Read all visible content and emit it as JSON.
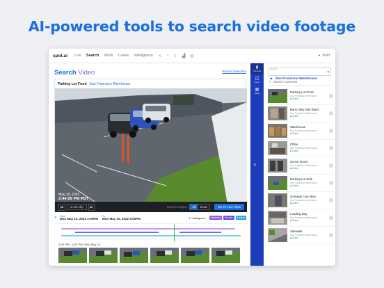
{
  "headline": "AI-powered tools to search video footage",
  "nav": {
    "logo": "spot.ai",
    "items": [
      "Live",
      "Search",
      "Walls",
      "Cases",
      "Intelligence"
    ],
    "active": "Search",
    "user": "Brett"
  },
  "search": {
    "title_main": "Search",
    "title_sub": "Video",
    "recent_link": "Recent Searches"
  },
  "camera_card": {
    "name": "Parking Lot Front",
    "location": "San Francisco Warehouse",
    "timestamp_date": "May 10, 2022",
    "timestamp_time": "2:44:05 PM PDT",
    "clip_label": "3 min clip",
    "search_region_label": "Search Region",
    "seg_all": "All",
    "seg_draw": "Draw",
    "live_button": "Go To Live View"
  },
  "filters": {
    "from_label": "From",
    "from_value": "Mon May 10, 2022 2:00PM",
    "to_label": "To",
    "to_value": "Mon May 10, 2022 4:00PM",
    "intelligence_label": "Intelligence",
    "chips": [
      {
        "label": "Vehicles",
        "color": "#8e5ce6"
      },
      {
        "label": "People",
        "color": "#6c4fd6"
      },
      {
        "label": "Motion",
        "color": "#2aa7d9"
      }
    ]
  },
  "results_label": "2:00 PM - 4:00 PM, Mon May 10",
  "sidebar": {
    "rail": [
      {
        "label": "Cameras",
        "icon": "video-camera-icon"
      },
      {
        "label": "Views",
        "icon": "camera-views-icon"
      },
      {
        "label": "Walls",
        "icon": "grid-icon"
      }
    ],
    "location_label": "Location",
    "location_value": "San Francisco Warehouse",
    "search_placeholder": "Search Cameras",
    "cameras": [
      {
        "name": "Parking Lot Front",
        "location": "San Francisco Warehouse",
        "status": "Online"
      },
      {
        "name": "Back Alley with Stairs",
        "location": "San Francisco Warehouse",
        "status": "Online"
      },
      {
        "name": "Warehouse",
        "location": "San Francisco Warehouse",
        "status": "Online"
      },
      {
        "name": "Office",
        "location": "San Francisco Warehouse",
        "status": "Online"
      },
      {
        "name": "Server Room",
        "location": "San Francisco Warehouse",
        "status": "Online"
      },
      {
        "name": "Parking Lot Side",
        "location": "San Francisco Warehouse",
        "status": "Online"
      },
      {
        "name": "Garbage Can Alley",
        "location": "San Francisco Warehouse",
        "status": "Online"
      },
      {
        "name": "Loading Bay",
        "location": "San Francisco Warehouse",
        "status": "Online"
      },
      {
        "name": "Sidewalk",
        "location": "San Francisco Warehouse",
        "status": "Online"
      }
    ]
  },
  "colors": {
    "accent": "#1b6fe0",
    "rail": "#1e3dbb",
    "online": "#22a04a",
    "purple": "#8e5ce6"
  }
}
